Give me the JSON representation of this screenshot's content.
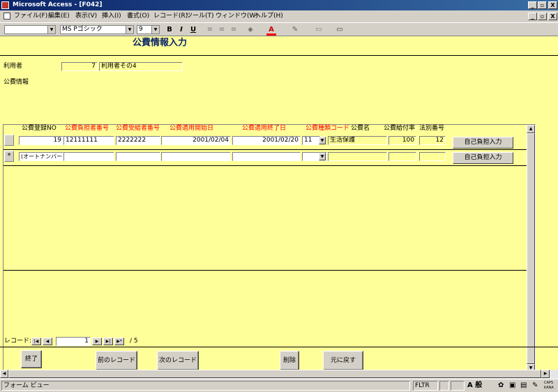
{
  "window": {
    "title": "Microsoft Access - [F042]",
    "controls": [
      "_",
      "▫",
      "X"
    ]
  },
  "menu": {
    "items": [
      "ファイル(F)",
      "編集(E)",
      "表示(V)",
      "挿入(I)",
      "書式(O)",
      "レコード(R)",
      "ツール(T)",
      "ウィンドウ(W)",
      "ヘルプ(H)"
    ],
    "doc_controls": [
      "_",
      "▫",
      "X"
    ]
  },
  "toolbar": {
    "object_combo": "",
    "font_name": "MS Pゴシック",
    "font_size": "9",
    "bold": "B",
    "italic": "I",
    "underline": "U"
  },
  "form": {
    "title": "公費情報入力",
    "user_label": "利用者",
    "user_id": "7",
    "user_name": "利用者その4",
    "section_label": "公費情報",
    "columns": [
      "公費登録NO",
      "公費負担者番号",
      "公費受給者番号",
      "公費適用開始日",
      "公費適用終了日",
      "公費種類コード",
      "公費名",
      "公費給付率",
      "法別番号"
    ],
    "columns_red": [
      false,
      true,
      true,
      true,
      true,
      true,
      false,
      false,
      false
    ],
    "row1": {
      "reg_no": "19",
      "payer_no": "12111111",
      "recipient_no": "2222222",
      "start_date": "2001/02/04",
      "end_date": "2001/02/20",
      "type_code": "11",
      "name": "生活保護",
      "rate": "100",
      "law_no": "12",
      "button": "自己負担入力"
    },
    "new_row": {
      "marker": "*",
      "reg_no": "(オートナンバー)",
      "button": "自己負担入力"
    },
    "buttons": {
      "prev": "前のレコード",
      "next": "次のレコード",
      "delete": "削除",
      "undo": "元に戻す",
      "exit": "終了"
    },
    "record_nav": {
      "label": "レコード:",
      "current": "1",
      "total": "/ 5"
    }
  },
  "status": {
    "text": "フォーム ビュー",
    "filter": "FLTR",
    "ime": "A 般",
    "caps": "CAPS",
    "kana": "KANA"
  },
  "colors": {
    "form_bg": "#ffff99",
    "label_red": "#ff0000",
    "title_blue": "#0a246a"
  }
}
